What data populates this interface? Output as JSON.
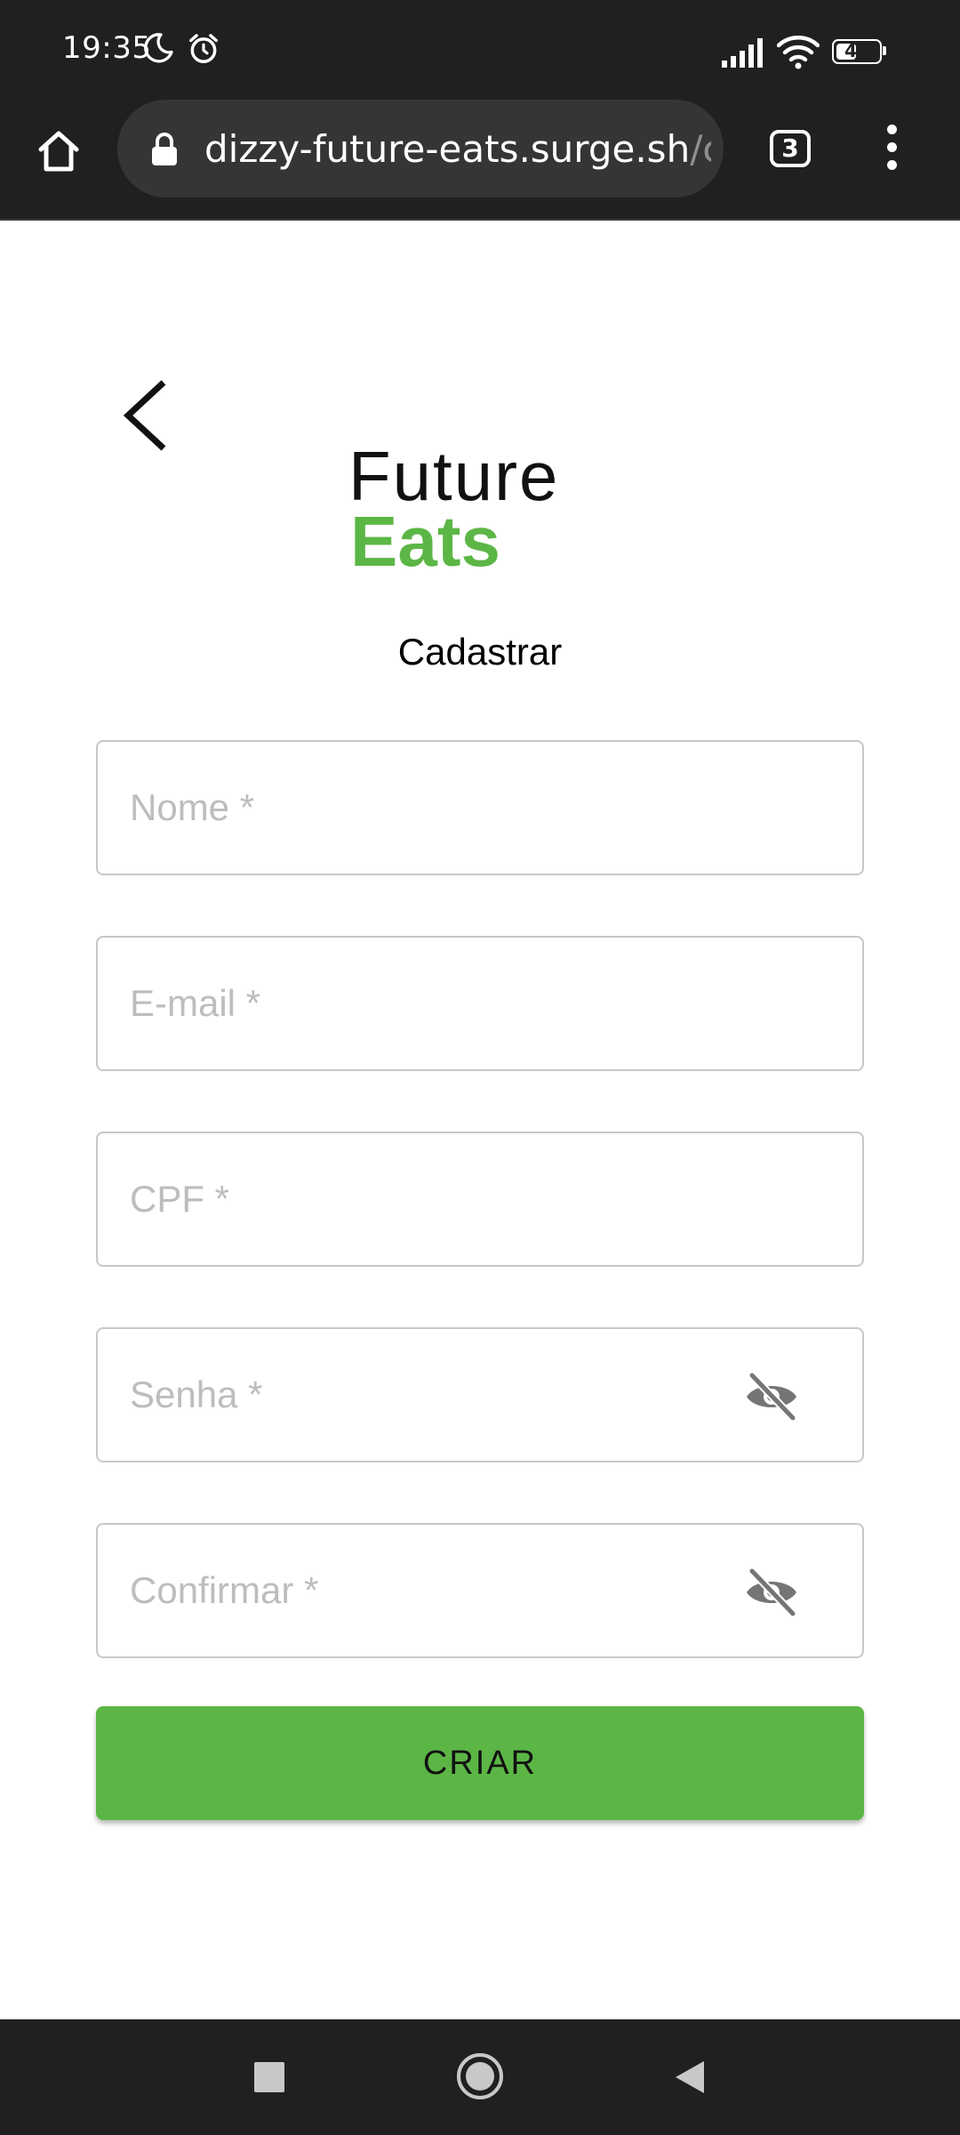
{
  "status_bar": {
    "time": "19:35",
    "battery_level": "48",
    "icons": [
      "moon-icon",
      "alarm-icon",
      "signal-icon",
      "wifi-icon",
      "battery-icon"
    ]
  },
  "browser": {
    "url_host": "dizzy-future-eats.surge.sh",
    "url_path": "/ca",
    "tab_count": "3",
    "icons": [
      "home-icon",
      "lock-icon",
      "more-vert-icon"
    ]
  },
  "page": {
    "logo": {
      "line1": "Future",
      "line2": "Eats"
    },
    "title": "Cadastrar",
    "fields": {
      "name": {
        "placeholder": "Nome *",
        "value": ""
      },
      "email": {
        "placeholder": "E-mail *",
        "value": ""
      },
      "cpf": {
        "placeholder": "CPF *",
        "value": ""
      },
      "password": {
        "placeholder": "Senha *",
        "value": ""
      },
      "confirm": {
        "placeholder": "Confirmar *",
        "value": ""
      }
    },
    "submit_label": "CRIAR"
  },
  "colors": {
    "brand_green": "#5cb646",
    "system_bar": "#202020",
    "url_pill": "#353535",
    "placeholder": "#bdbdbd",
    "field_border": "#c8c8c8"
  }
}
